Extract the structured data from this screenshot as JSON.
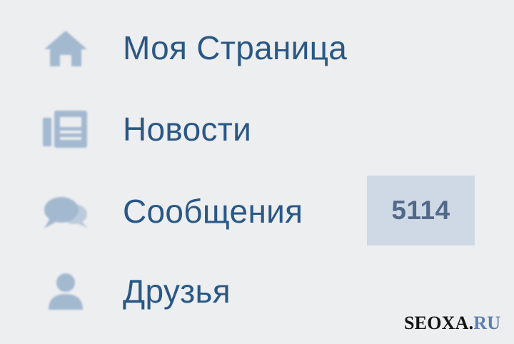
{
  "menu": {
    "items": [
      {
        "label": "Моя Страница",
        "icon": "home-icon"
      },
      {
        "label": "Новости",
        "icon": "news-icon"
      },
      {
        "label": "Сообщения",
        "icon": "messages-icon",
        "badge": "5114"
      },
      {
        "label": "Друзья",
        "icon": "friends-icon"
      }
    ]
  },
  "watermark": {
    "brand": "SEOXA",
    "dot": ".",
    "tld": "RU"
  },
  "colors": {
    "background": "#edeef0",
    "link": "#2a5885",
    "icon": "#a3b9d0",
    "badge_bg": "#cfd9e5",
    "badge_text": "#53698a"
  }
}
